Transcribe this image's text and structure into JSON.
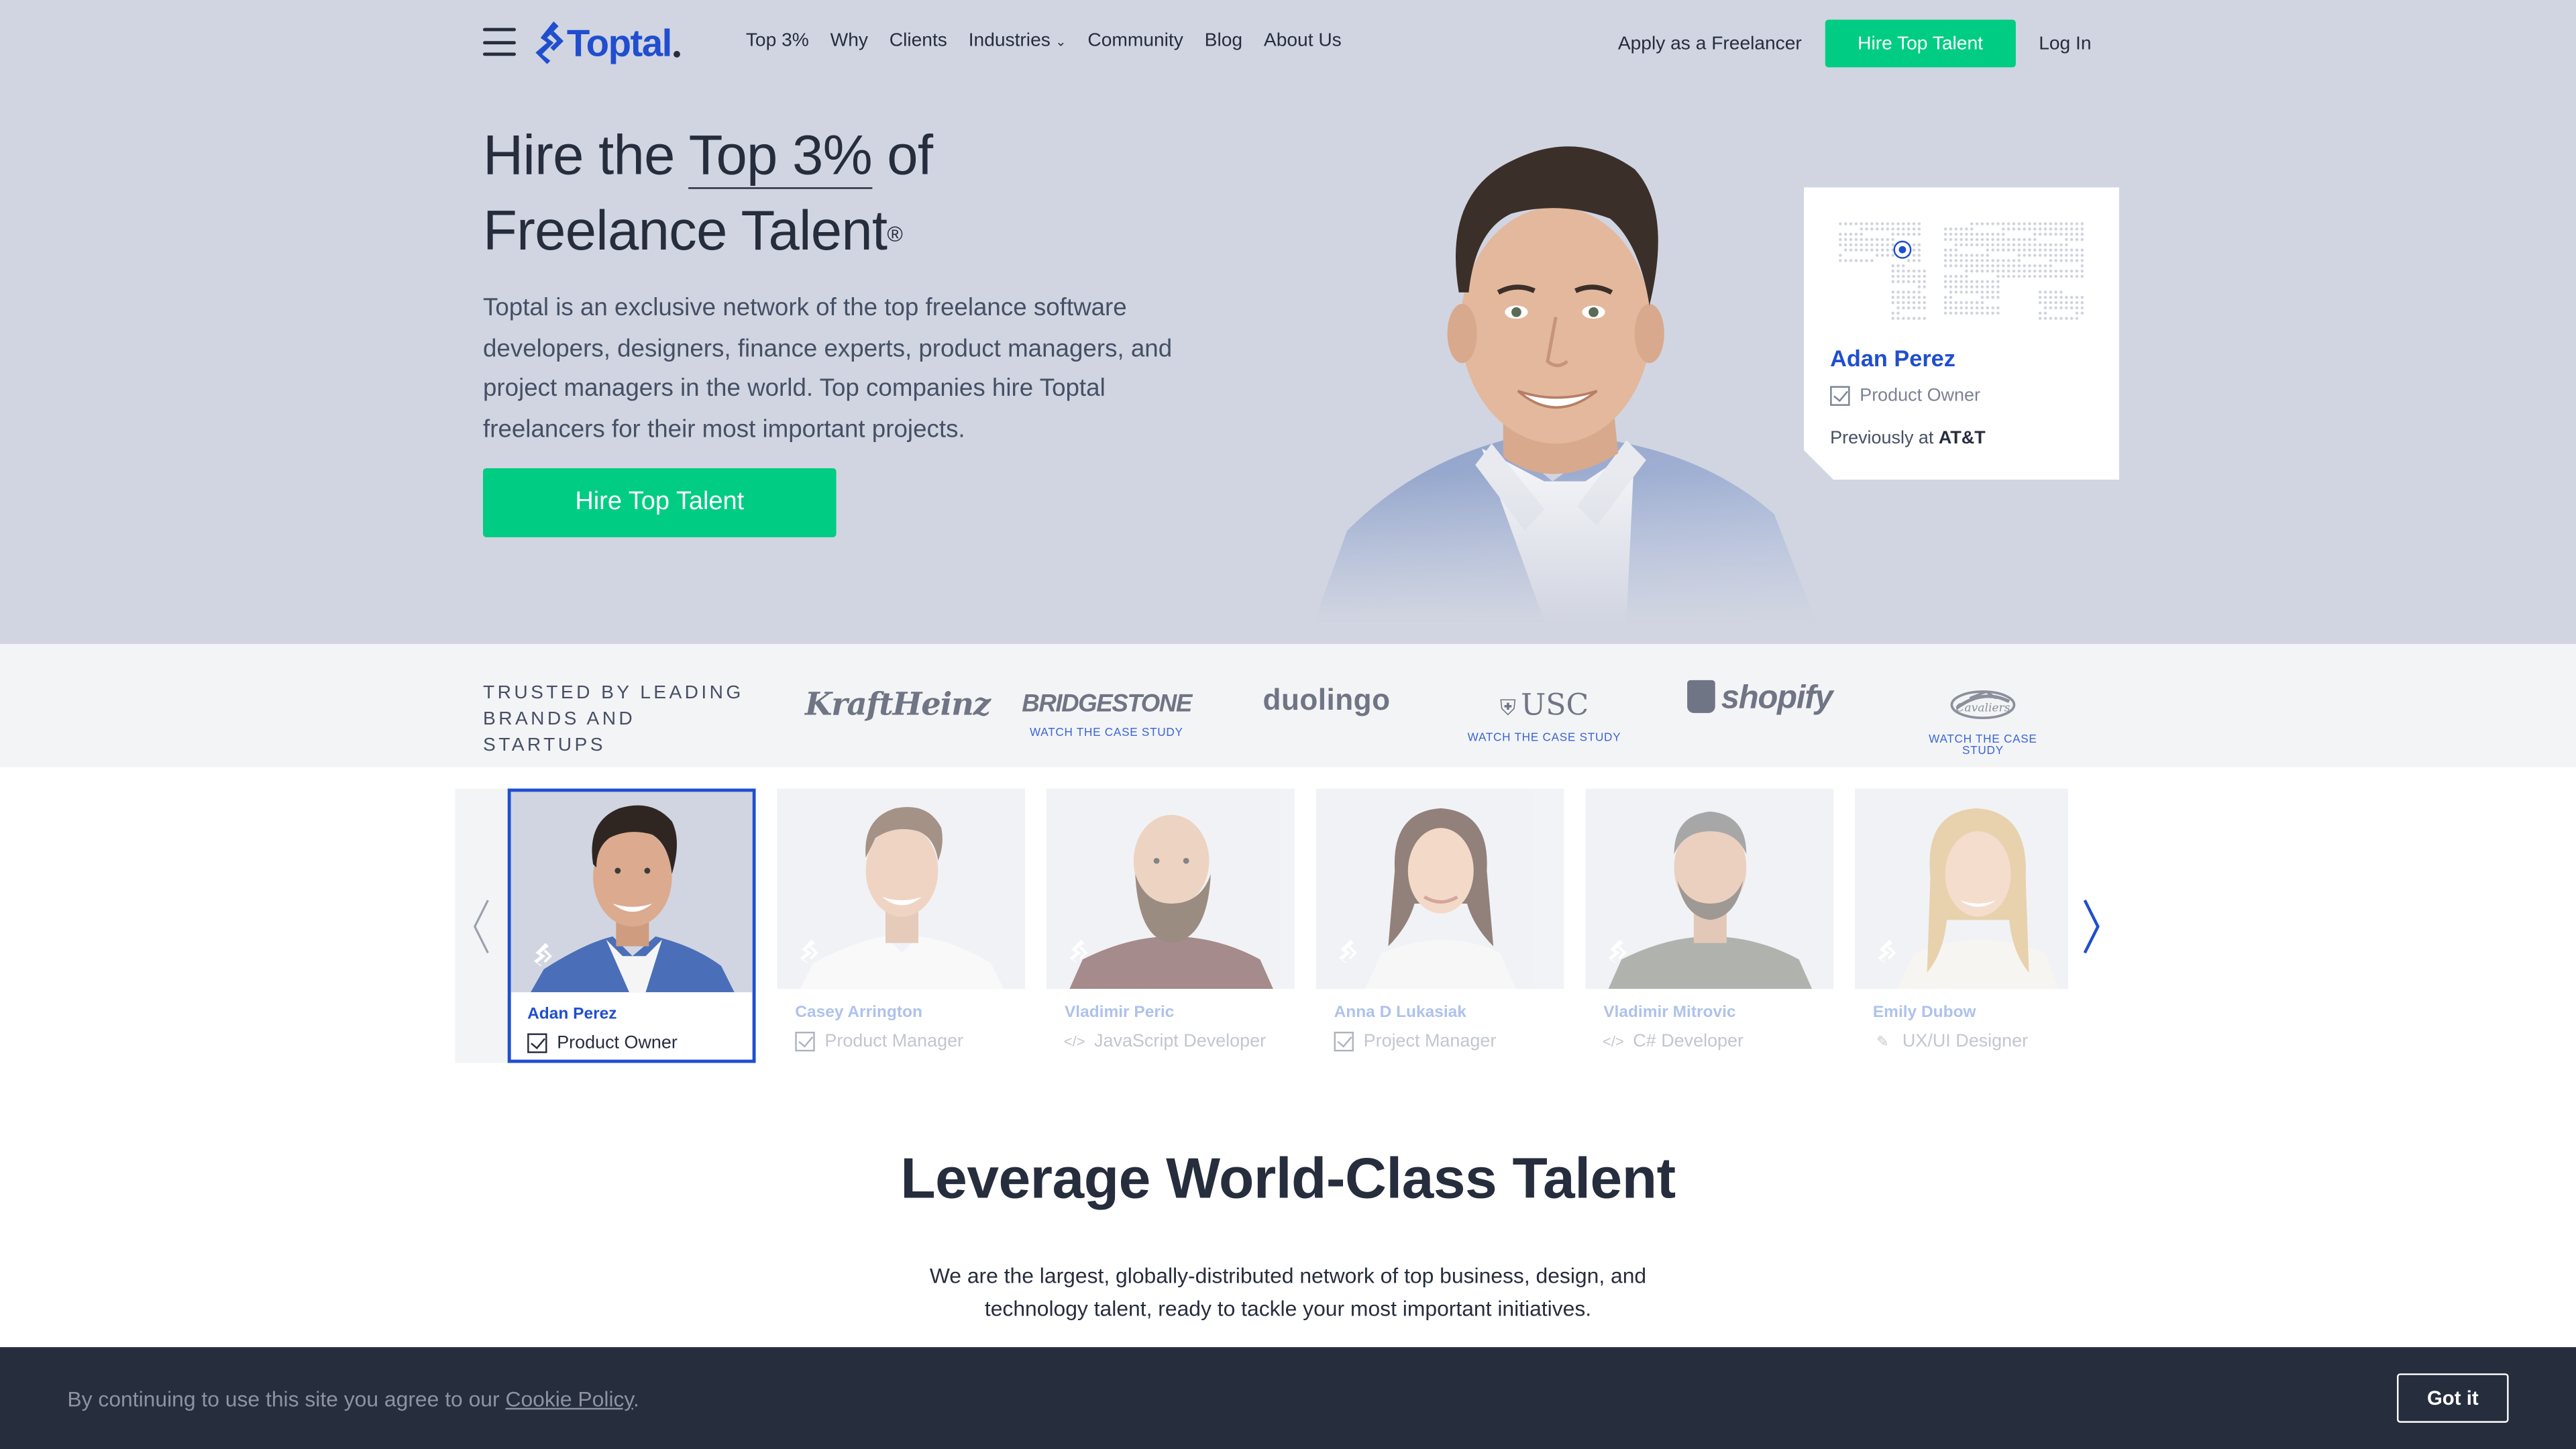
{
  "nav": {
    "brand": "Toptal",
    "links": [
      "Top 3%",
      "Why",
      "Clients",
      "Industries",
      "Community",
      "Blog",
      "About Us"
    ],
    "apply_label": "Apply as a Freelancer",
    "hire_label": "Hire Top Talent",
    "login_label": "Log In"
  },
  "hero": {
    "title_part1": "Hire the ",
    "title_highlight": "Top 3%",
    "title_part2": " of",
    "title_line2": "Freelance Talent",
    "title_reg": "®",
    "description": "Toptal is an exclusive network of the top freelance software developers, designers, finance experts, product managers, and project managers in the world. Top companies hire Toptal freelancers for their most important projects.",
    "cta_label": "Hire Top Talent"
  },
  "profile_card": {
    "name": "Adan Perez",
    "role": "Product Owner",
    "previously_label": "Previously at ",
    "previously_company": "AT&T"
  },
  "trusted": {
    "label": "TRUSTED BY LEADING BRANDS AND STARTUPS",
    "brands": [
      {
        "name": "KraftHeinz",
        "case_study": ""
      },
      {
        "name": "BRIDGESTONE",
        "case_study": "WATCH THE CASE STUDY"
      },
      {
        "name": "duolingo",
        "case_study": ""
      },
      {
        "name": "USC",
        "case_study": "WATCH THE CASE STUDY"
      },
      {
        "name": "shopify",
        "case_study": ""
      },
      {
        "name": "Cavaliers",
        "case_study": "WATCH THE CASE STUDY"
      }
    ]
  },
  "talent": [
    {
      "name": "Adan Perez",
      "role": "Product Owner",
      "icon": "checkbox-icon"
    },
    {
      "name": "Casey Arrington",
      "role": "Product Manager",
      "icon": "checkbox-icon"
    },
    {
      "name": "Vladimir Peric",
      "role": "JavaScript Developer",
      "icon": "code-icon"
    },
    {
      "name": "Anna D Lukasiak",
      "role": "Project Manager",
      "icon": "checkbox-icon"
    },
    {
      "name": "Vladimir Mitrovic",
      "role": "C# Developer",
      "icon": "code-icon"
    },
    {
      "name": "Emily Dubow",
      "role": "UX/UI Designer",
      "icon": "pen-icon"
    }
  ],
  "leverage": {
    "title": "Leverage World-Class Talent",
    "description": "We are the largest, globally-distributed network of top business, design, and technology talent, ready to tackle your most important initiatives."
  },
  "cookie": {
    "text": "By continuing to use this site you agree to our ",
    "link": "Cookie Policy",
    "suffix": ".",
    "button": "Got it"
  },
  "colors": {
    "hero_bg": "#d1d5e1",
    "accent_green": "#00cc83",
    "brand_blue": "#204ecf",
    "dark": "#262d3d"
  }
}
